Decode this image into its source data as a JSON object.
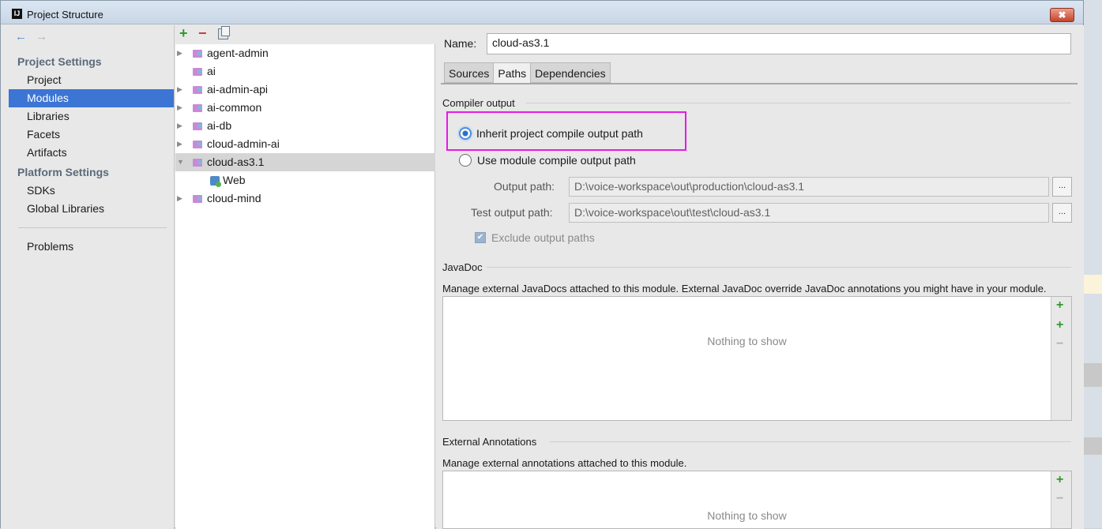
{
  "window": {
    "title": "Project Structure",
    "close_label": "✖"
  },
  "nav": {
    "back_icon": "←",
    "forward_icon": "→",
    "project_settings_header": "Project Settings",
    "project_items": [
      "Project",
      "Modules",
      "Libraries",
      "Facets",
      "Artifacts"
    ],
    "platform_settings_header": "Platform Settings",
    "platform_items": [
      "SDKs",
      "Global Libraries"
    ],
    "problems": "Problems",
    "selected": "Modules"
  },
  "tree": {
    "toolbar": {
      "add": "+",
      "remove": "−"
    },
    "rows": [
      {
        "label": "agent-admin",
        "expandable": true
      },
      {
        "label": "ai",
        "expandable": false
      },
      {
        "label": "ai-admin-api",
        "expandable": true
      },
      {
        "label": "ai-common",
        "expandable": true
      },
      {
        "label": "ai-db",
        "expandable": true
      },
      {
        "label": "cloud-admin-ai",
        "expandable": true
      },
      {
        "label": "cloud-as3.1",
        "expandable": true,
        "expanded": true,
        "selected": true
      },
      {
        "label": "Web",
        "child": true
      },
      {
        "label": "cloud-mind",
        "expandable": true
      }
    ]
  },
  "details": {
    "name_label": "Name:",
    "name_value": "cloud-as3.1",
    "tabs": [
      "Sources",
      "Paths",
      "Dependencies"
    ],
    "active_tab": "Paths",
    "compiler_output": {
      "title": "Compiler output",
      "inherit_label": "Inherit project compile output path",
      "use_module_label": "Use module compile output path",
      "selected": "inherit",
      "output_path_label": "Output path:",
      "output_path_value": "D:\\voice-workspace\\out\\production\\cloud-as3.1",
      "test_output_path_label": "Test output path:",
      "test_output_path_value": "D:\\voice-workspace\\out\\test\\cloud-as3.1",
      "browse_label": "...",
      "exclude_label": "Exclude output paths",
      "exclude_checked": true
    },
    "javadoc": {
      "title": "JavaDoc",
      "description": "Manage external JavaDocs attached to this module. External JavaDoc override JavaDoc annotations you might have in your module.",
      "empty_text": "Nothing to show"
    },
    "external_annotations": {
      "title": "External Annotations",
      "description": "Manage external annotations attached to this module.",
      "empty_text": "Nothing to show"
    }
  },
  "colors": {
    "selection": "#3c75d4",
    "highlight_box": "#e61ae6",
    "add_green": "#2e9a2e",
    "remove_red": "#c83c3c"
  }
}
